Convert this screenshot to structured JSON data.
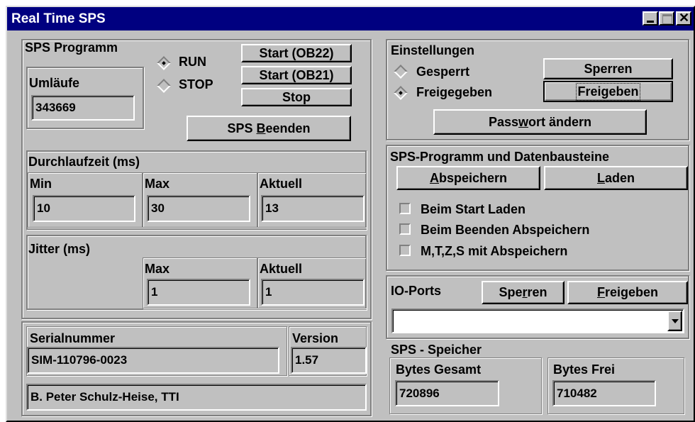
{
  "window": {
    "title": "Real Time SPS"
  },
  "sps_programm": {
    "title": "SPS Programm",
    "run_label": "RUN",
    "stop_label": "STOP",
    "mode_selected": "RUN",
    "start_ob22": "Start (OB22)",
    "start_ob21": "Start (OB21)",
    "stop_button": "Stop",
    "umlaeufe_label": "Umläufe",
    "umlaeufe_value": "343669",
    "beenden_pre": "SPS ",
    "beenden_accel": "B",
    "beenden_post": "eenden"
  },
  "durchlaufzeit": {
    "title": "Durchlaufzeit (ms)",
    "min_label": "Min",
    "min_value": "10",
    "max_label": "Max",
    "max_value": "30",
    "aktuell_label": "Aktuell",
    "aktuell_value": "13"
  },
  "jitter": {
    "title": "Jitter (ms)",
    "max_label": "Max",
    "max_value": "1",
    "aktuell_label": "Aktuell",
    "aktuell_value": "1"
  },
  "info": {
    "serial_label": "Serialnummer",
    "serial_value": "SIM-110796-0023",
    "version_label": "Version",
    "version_value": "1.57",
    "author": "B. Peter Schulz-Heise, TTI"
  },
  "einstellungen": {
    "title": "Einstellungen",
    "gesperrt": "Gesperrt",
    "freigegeben": "Freigegeben",
    "selected": "Freigegeben",
    "sperren_button": "Sperren",
    "freigeben_button": "Freigeben",
    "passwort_pre": "Pass",
    "passwort_accel": "w",
    "passwort_post": "ort ändern"
  },
  "programm_daten": {
    "title": "SPS-Programm und Datenbausteine",
    "abspeichern_accel": "A",
    "abspeichern_rest": "bspeichern",
    "laden_accel": "L",
    "laden_rest": "aden",
    "opt_start_laden": "Beim Start Laden",
    "opt_beenden_abspeichern": "Beim Beenden Abspeichern",
    "opt_mtzs": "M,T,Z,S mit Abspeichern"
  },
  "io_ports": {
    "title": "IO-Ports",
    "sperren_pre": "Spe",
    "sperren_accel": "r",
    "sperren_post": "ren",
    "freigeben_accel": "F",
    "freigeben_rest": "reigeben",
    "dropdown_value": ""
  },
  "speicher": {
    "title": "SPS - Speicher",
    "gesamt_label": "Bytes Gesamt",
    "gesamt_value": "720896",
    "frei_label": "Bytes Frei",
    "frei_value": "710482"
  }
}
